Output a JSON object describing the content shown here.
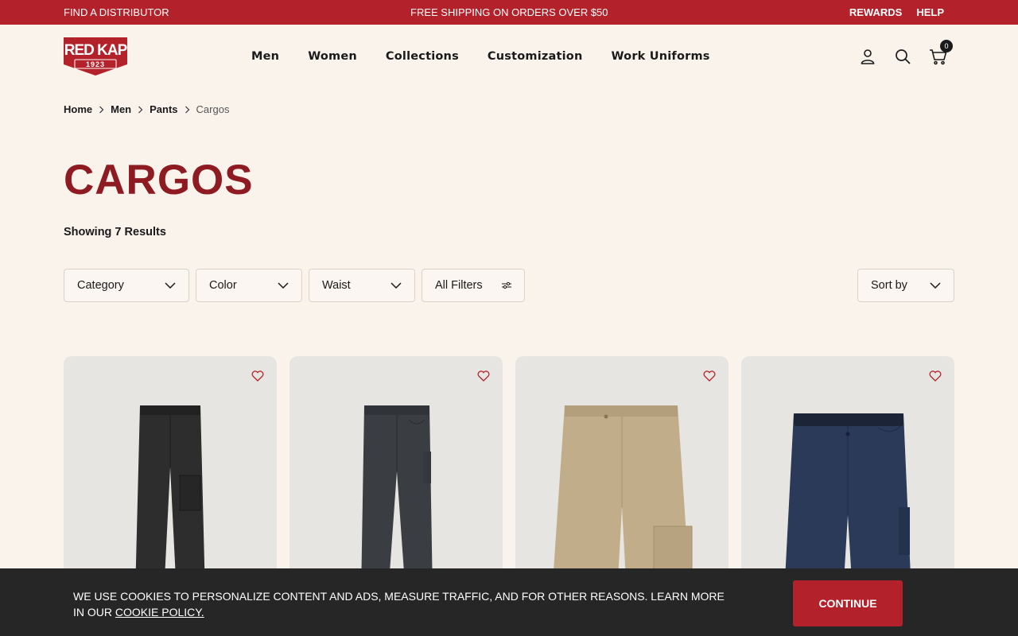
{
  "topbar": {
    "distributor": "FIND A DISTRIBUTOR",
    "shipping": "FREE SHIPPING ON ORDERS OVER $50",
    "rewards": "REWARDS",
    "help": "HELP"
  },
  "brand": {
    "logo_text": "RED KAP",
    "logo_year": "1923",
    "color": "#b3222a"
  },
  "nav": [
    "Men",
    "Women",
    "Collections",
    "Customization",
    "Work Uniforms"
  ],
  "header_icons": [
    "account-icon",
    "search-icon",
    "cart-icon"
  ],
  "cart_count": "0",
  "breadcrumb": [
    "Home",
    "Men",
    "Pants",
    "Cargos"
  ],
  "page_title": "CARGOS",
  "results_text": "Showing 7 Results",
  "filters": [
    "Category",
    "Color",
    "Waist",
    "All Filters"
  ],
  "sort_label": "Sort by",
  "products": [
    {
      "color": "#2d2d2d",
      "style": "black cargo pant"
    },
    {
      "color": "#3a3d42",
      "style": "charcoal cargo pant"
    },
    {
      "color": "#c2ad8a",
      "style": "khaki cargo pant"
    },
    {
      "color": "#2b3a59",
      "style": "navy cargo pant"
    }
  ],
  "cookie": {
    "text": "WE USE COOKIES TO PERSONALIZE CONTENT AND ADS, MEASURE TRAFFIC, AND FOR OTHER REASONS. LEARN MORE IN OUR",
    "link": "COOKIE POLICY.",
    "button": "CONTINUE"
  }
}
